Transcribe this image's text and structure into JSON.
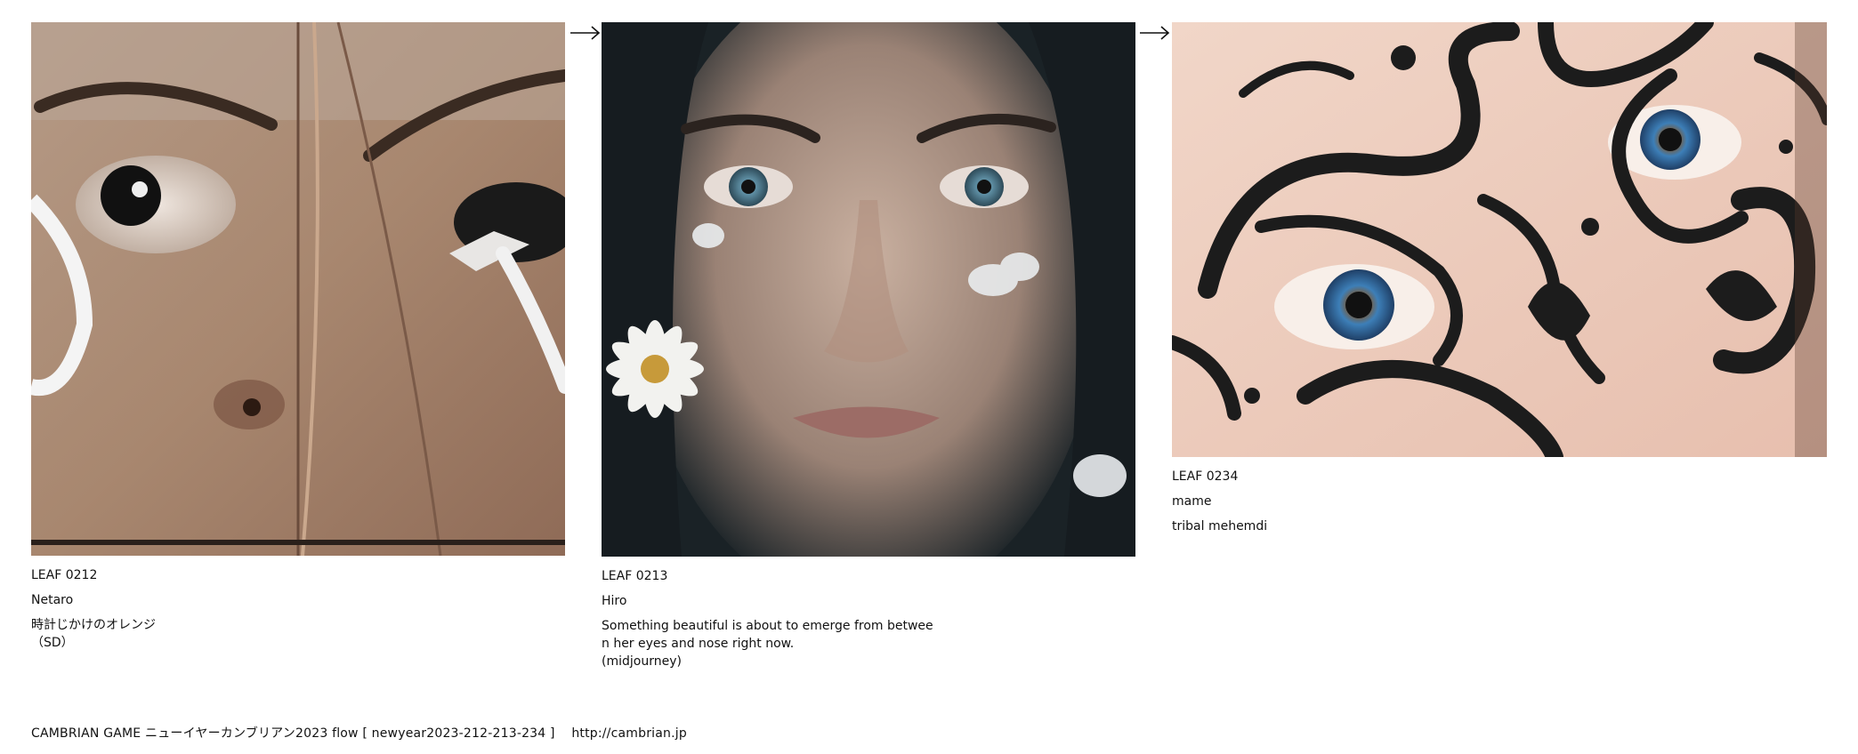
{
  "leaves": [
    {
      "code": "LEAF 0212",
      "author": "Netaro",
      "desc": "時計じかけのオレンジ\n（SD）",
      "image_icon": "face-clockwork-eye-image"
    },
    {
      "code": "LEAF 0213",
      "author": "Hiro",
      "desc": "Something beautiful is about to emerge from betwee\nn her eyes and nose right now.\n(midjourney)",
      "image_icon": "face-flowers-image"
    },
    {
      "code": "LEAF 0234",
      "author": "mame",
      "desc": "tribal mehemdi",
      "image_icon": "tribal-eye-image"
    }
  ],
  "arrows": [
    "arrow-right-icon",
    "arrow-right-icon"
  ],
  "footer": {
    "text": "CAMBRIAN GAME  ニューイヤーカンブリアン2023  flow [ newyear2023-212-213-234 ]",
    "link": "http://cambrian.jp"
  }
}
